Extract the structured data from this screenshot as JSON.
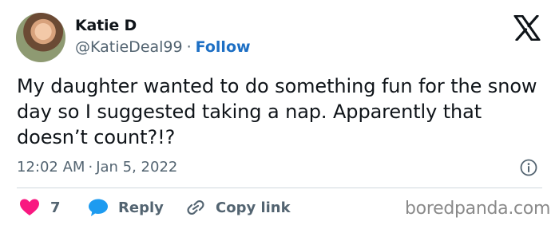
{
  "author": {
    "name": "Katie D",
    "handle": "@KatieDeal99",
    "separator": "·",
    "follow_label": "Follow"
  },
  "platform_icon": "x-logo-icon",
  "tweet": {
    "text": "My daughter wanted to do something fun for the snow day so I suggested taking a nap. Apparently that doesn’t count?!?",
    "time": "12:02 AM",
    "separator": "·",
    "date": "Jan 5, 2022"
  },
  "actions": {
    "like_icon": "heart-icon",
    "like_count": "7",
    "reply_icon": "speech-bubble-icon",
    "reply_label": "Reply",
    "copy_icon": "link-icon",
    "copy_label": "Copy link"
  },
  "colors": {
    "like": "#f91880",
    "reply": "#1d9bf0",
    "follow": "#1d6fc4",
    "muted": "#536471"
  },
  "watermark": "boredpanda.com"
}
